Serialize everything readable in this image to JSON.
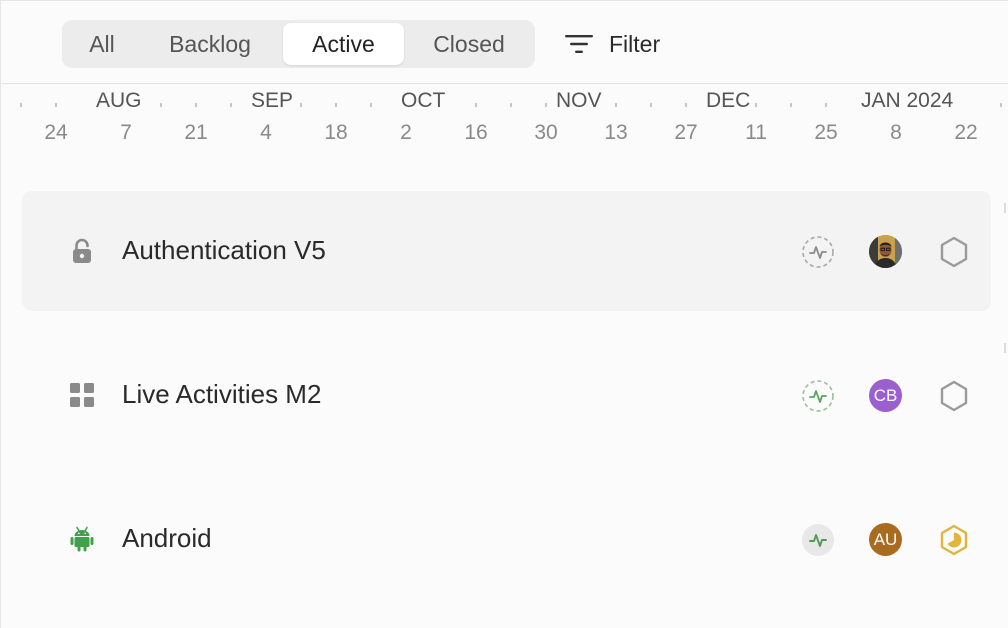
{
  "tabs": [
    {
      "label": "All",
      "active": false
    },
    {
      "label": "Backlog",
      "active": false
    },
    {
      "label": "Active",
      "active": true
    },
    {
      "label": "Closed",
      "active": false
    }
  ],
  "filter": {
    "label": "Filter",
    "icon": "filter-icon"
  },
  "timeline": {
    "months": [
      "AUG",
      "SEP",
      "OCT",
      "NOV",
      "DEC",
      "JAN 2024"
    ],
    "days": [
      "24",
      "7",
      "21",
      "4",
      "18",
      "2",
      "16",
      "30",
      "13",
      "27",
      "11",
      "25",
      "8",
      "22"
    ]
  },
  "projects": [
    {
      "title": "Authentication V5",
      "icon": "lock-icon",
      "health_icon": "health-pulse-dashed-icon",
      "assignee": {
        "initials": "",
        "type": "photo"
      },
      "priority_icon": "hexagon-outline-icon"
    },
    {
      "title": "Live Activities M2",
      "icon": "grid-icon",
      "health_icon": "health-pulse-dashed-green-icon",
      "assignee": {
        "initials": "CB",
        "color": "#9b5fd0"
      },
      "priority_icon": "hexagon-outline-icon"
    },
    {
      "title": "Android",
      "icon": "android-icon",
      "health_icon": "health-pulse-filled-icon",
      "assignee": {
        "initials": "AU",
        "color": "#a86b1f"
      },
      "priority_icon": "hexagon-progress-yellow-icon"
    }
  ],
  "colors": {
    "accent_green": "#5aa35a",
    "android_green": "#3fa14a",
    "priority_yellow": "#e0b53a",
    "muted_gray": "#9a9a9a"
  }
}
